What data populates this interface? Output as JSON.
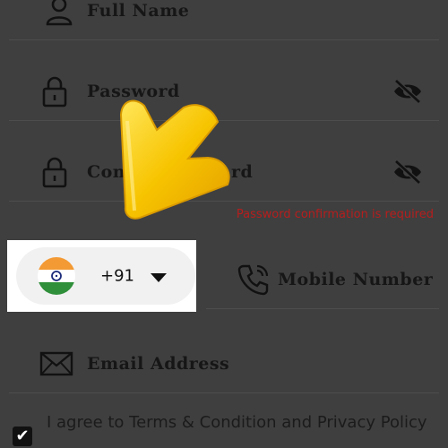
{
  "form": {
    "full_name_placeholder": "Full Name",
    "password_placeholder": "Password",
    "confirm_password_placeholder": "Confirm Password",
    "confirm_password_visible": "Con",
    "confirm_password_tail": "rd",
    "password_error": "Password confirmation is required",
    "country_code": "+91",
    "country_flag": "india-flag",
    "mobile_placeholder": "Mobile Number",
    "email_placeholder": "Email Address",
    "terms_label": "I agree to Terms & Condition and Privacy Policy",
    "terms_checked": true
  },
  "icons": {
    "user": "user-icon",
    "lock": "lock-icon",
    "eye_off": "eye-off-icon",
    "phone": "phone-icon",
    "mail": "mail-icon",
    "dropdown": "chevron-down-icon"
  },
  "colors": {
    "overlay": "#3f3f3f",
    "error": "#b71d1d",
    "arrow": "#f7c400"
  }
}
